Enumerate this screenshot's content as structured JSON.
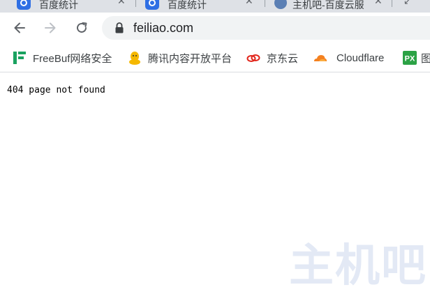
{
  "tabs": [
    {
      "title": "百度统计",
      "favicon": "baidu-tongji-icon"
    },
    {
      "title": "百度统计",
      "favicon": "baidu-tongji-icon"
    },
    {
      "title": "主机吧-百度云服",
      "favicon": "globe-icon"
    }
  ],
  "toolbar": {
    "url": "feiliao.com"
  },
  "bookmarks": [
    {
      "label": "FreeBuf网络安全",
      "icon": "freebuf-icon",
      "color": "#1aa260"
    },
    {
      "label": "腾讯内容开放平台",
      "icon": "penguin-icon",
      "color": "#f5b800"
    },
    {
      "label": "京东云",
      "icon": "jdcloud-icon",
      "color": "#e1251b"
    },
    {
      "label": "Cloudflare",
      "icon": "cloudflare-icon",
      "color": "#f48120"
    },
    {
      "label": "图",
      "icon": "px-icon",
      "color": "#2ba245"
    }
  ],
  "page": {
    "message": "404 page not found",
    "watermark": "主机吧"
  },
  "colors": {
    "tabstrip": "#dee1e6",
    "omnibox": "#f1f3f4",
    "accent_blue": "#2f6fe4"
  }
}
